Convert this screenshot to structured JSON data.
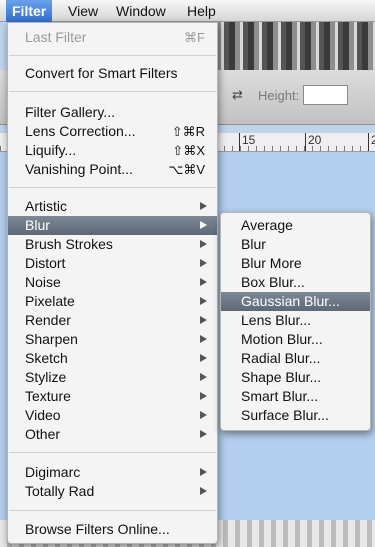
{
  "menubar": {
    "items": [
      "Filter",
      "View",
      "Window",
      "Help"
    ],
    "active": "Filter"
  },
  "options_bar": {
    "height_label": "Height:",
    "height_value": ""
  },
  "ruler": {
    "ticks": [
      "15",
      "20",
      "2"
    ]
  },
  "filter_menu": {
    "last_filter": {
      "label": "Last Filter",
      "shortcut": "⌘F"
    },
    "convert_smart": "Convert for Smart Filters",
    "filter_gallery": "Filter Gallery...",
    "lens_correction": {
      "label": "Lens Correction...",
      "shortcut": "⇧⌘R"
    },
    "liquify": {
      "label": "Liquify...",
      "shortcut": "⇧⌘X"
    },
    "vanishing_point": {
      "label": "Vanishing Point...",
      "shortcut": "⌥⌘V"
    },
    "categories": [
      "Artistic",
      "Blur",
      "Brush Strokes",
      "Distort",
      "Noise",
      "Pixelate",
      "Render",
      "Sharpen",
      "Sketch",
      "Stylize",
      "Texture",
      "Video",
      "Other"
    ],
    "highlighted_category": "Blur",
    "plugins": [
      "Digimarc",
      "Totally Rad"
    ],
    "browse_online": "Browse Filters Online..."
  },
  "blur_submenu": {
    "items": [
      "Average",
      "Blur",
      "Blur More",
      "Box Blur...",
      "Gaussian Blur...",
      "Lens Blur...",
      "Motion Blur...",
      "Radial Blur...",
      "Shape Blur...",
      "Smart Blur...",
      "Surface Blur..."
    ],
    "highlighted": "Gaussian Blur..."
  }
}
